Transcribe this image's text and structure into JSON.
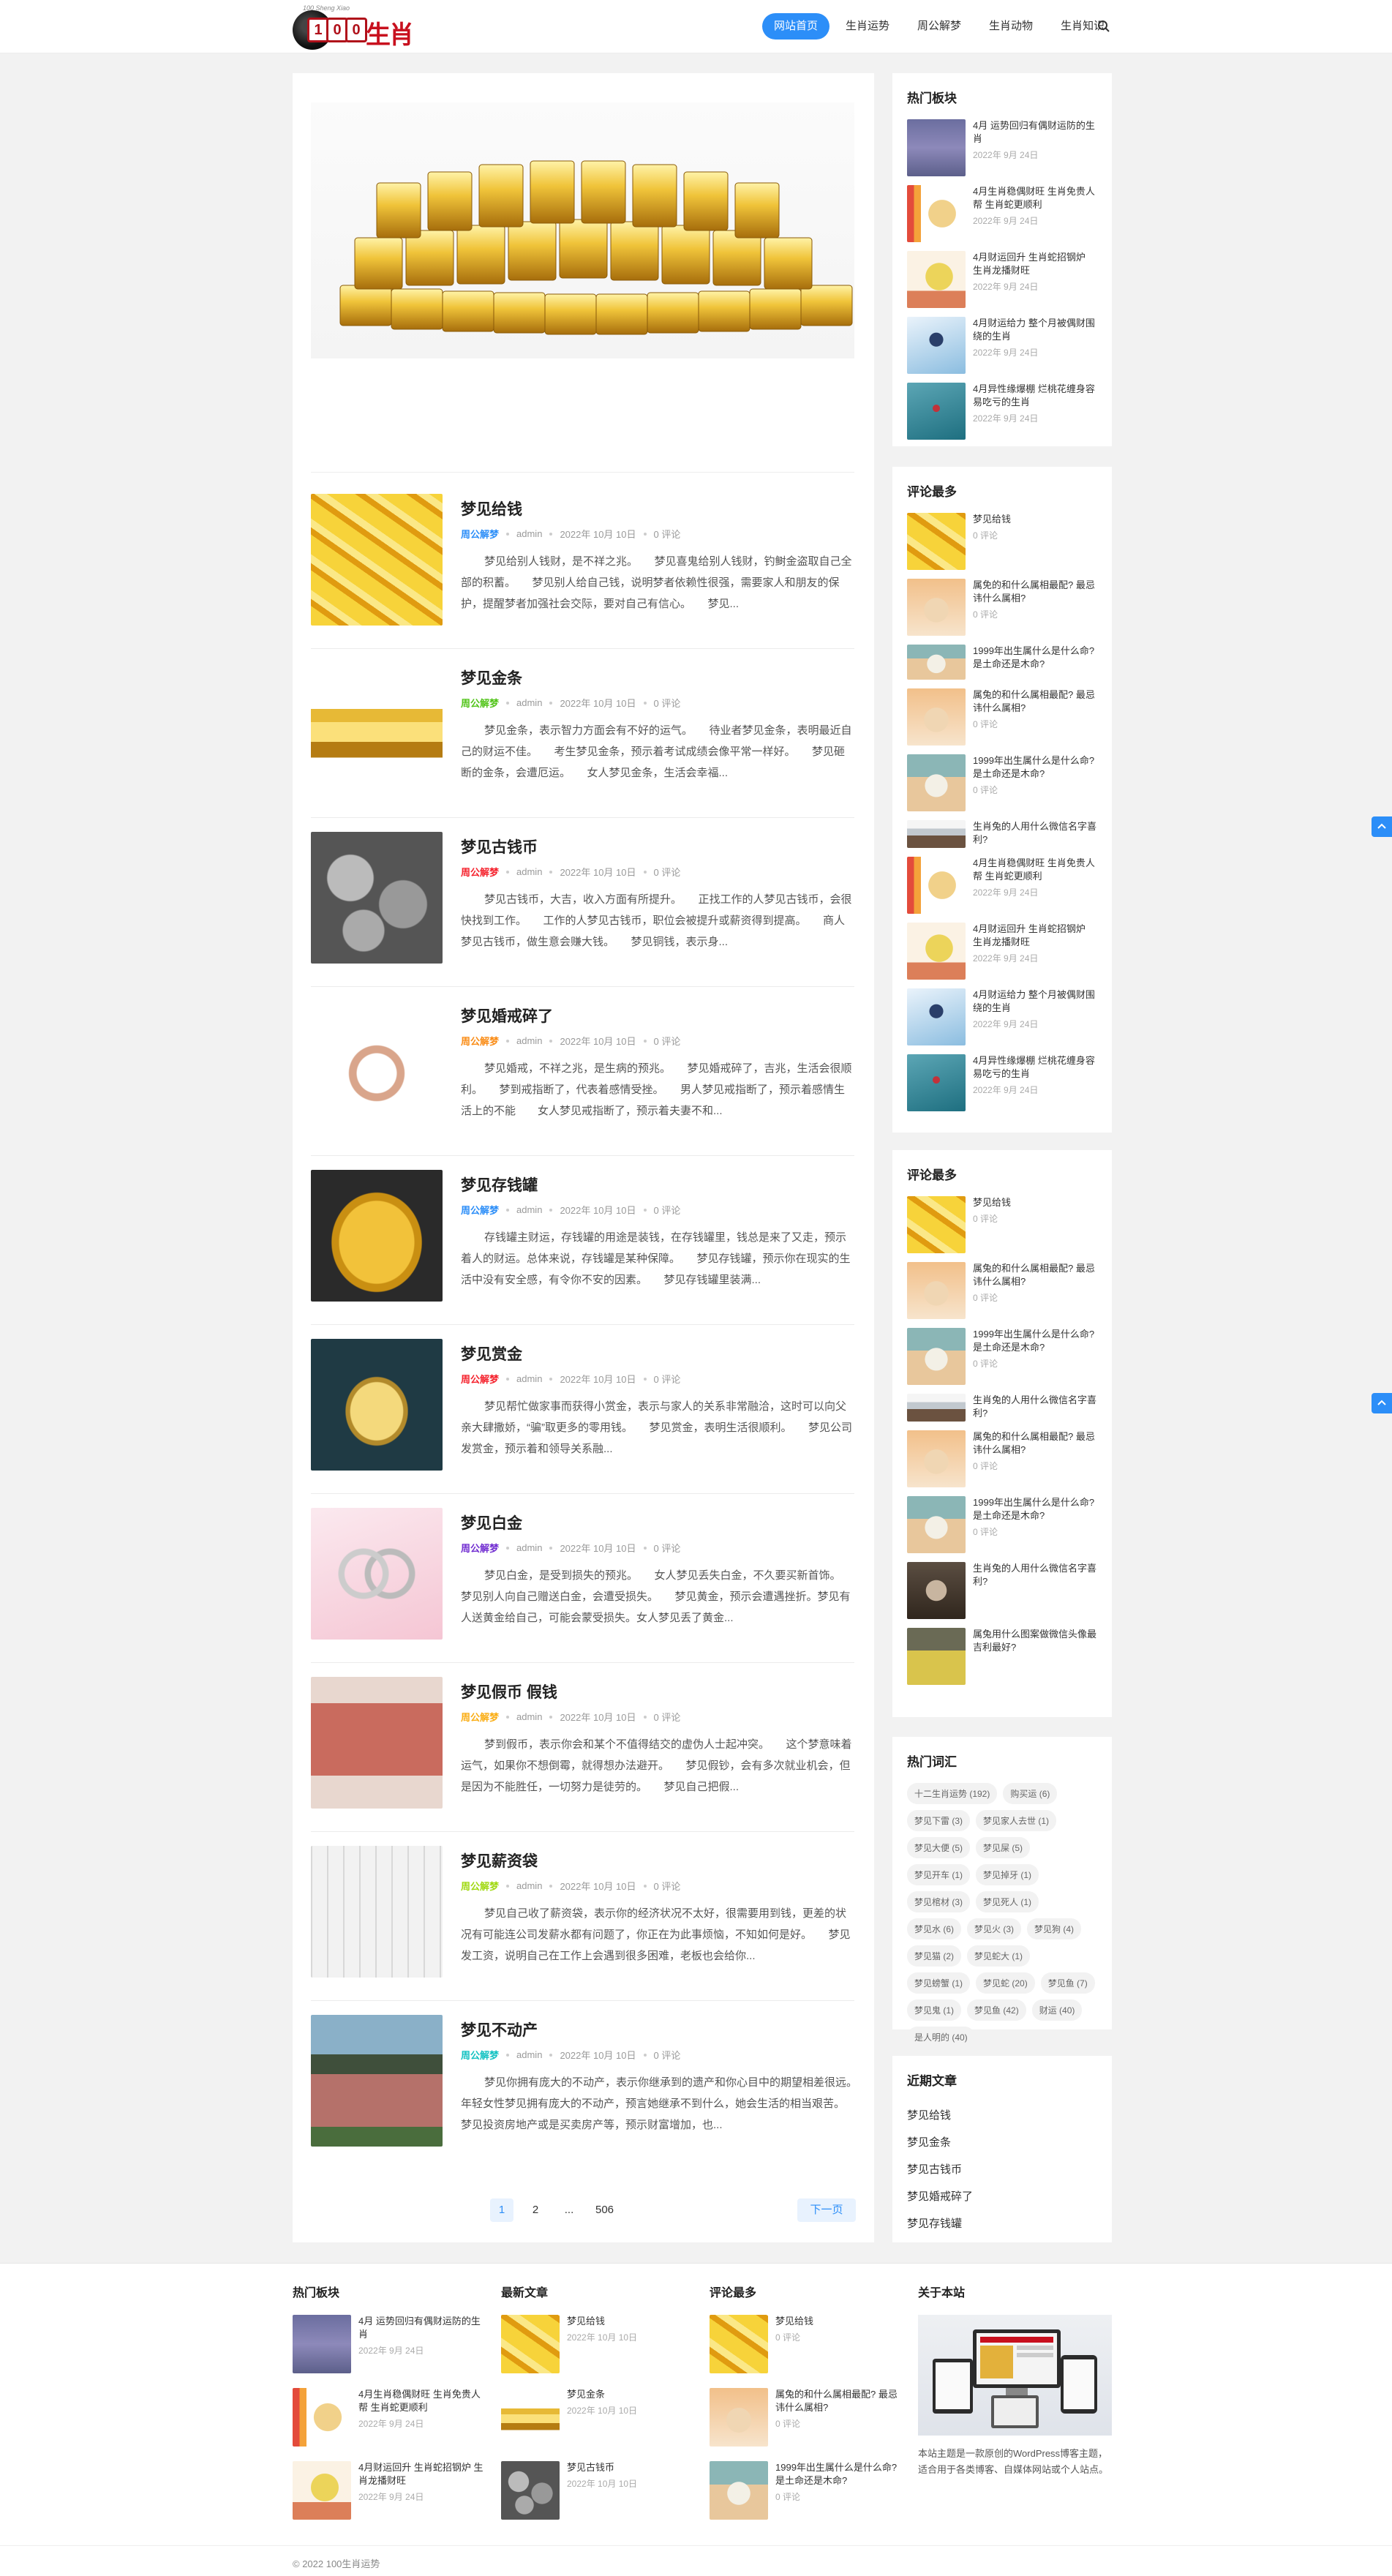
{
  "header": {
    "logo_tagline": "100 Sheng Xiao",
    "logo_digit_1": "1",
    "logo_digit_2": "0",
    "logo_digit_3": "0",
    "logo_text": "生肖",
    "nav": [
      "网站首页",
      "生肖运势",
      "周公解梦",
      "生肖动物",
      "生肖知识"
    ]
  },
  "posts": [
    {
      "title": "梦见给钱",
      "category": "周公解梦",
      "cat_color": "#2c8ef8",
      "author": "admin",
      "date": "2022年 10月 10日",
      "comments": "0 评论",
      "excerpt": "梦见给别人钱财，是不祥之兆。　　梦见喜鬼给别人钱财，钓鲥金盗取自己全部的积蓄。　　梦见别人给自己钱，说明梦者依赖性很强，需要家人和朋友的保护，提醒梦者加强社会交际，要对自己有信心。　　梦见..."
    },
    {
      "title": "梦见金条",
      "category": "周公解梦",
      "cat_color": "#52c41a",
      "author": "admin",
      "date": "2022年 10月 10日",
      "comments": "0 评论",
      "excerpt": "梦见金条，表示智力方面会有不好的运气。　　待业者梦见金条，表明最近自己的财运不佳。　　考生梦见金条，预示着考试成绩会像平常一样好。　　梦见砸断的金条，会遭厄运。　　女人梦见金条，生活会幸福..."
    },
    {
      "title": "梦见古钱币",
      "category": "周公解梦",
      "cat_color": "#f5222d",
      "author": "admin",
      "date": "2022年 10月 10日",
      "comments": "0 评论",
      "excerpt": "梦见古钱币，大吉，收入方面有所提升。　　正找工作的人梦见古钱币，会很快找到工作。　　工作的人梦见古钱币，职位会被提升或薪资得到提高。　　商人梦见古钱币，做生意会赚大钱。　　梦见铜钱，表示身..."
    },
    {
      "title": "梦见婚戒碎了",
      "category": "周公解梦",
      "cat_color": "#fa8c16",
      "author": "admin",
      "date": "2022年 10月 10日",
      "comments": "0 评论",
      "excerpt": "梦见婚戒，不祥之兆，是生病的预兆。　　梦见婚戒碎了，吉兆，生活会很顺利。　　梦到戒指断了，代表着感情受挫。　　男人梦见戒指断了，预示着感情生活上的不能　　女人梦见戒指断了，预示着夫妻不和..."
    },
    {
      "title": "梦见存钱罐",
      "category": "周公解梦",
      "cat_color": "#2c8ef8",
      "author": "admin",
      "date": "2022年 10月 10日",
      "comments": "0 评论",
      "excerpt": "存钱罐主财运，存钱罐的用途是装钱，在存钱罐里，钱总是来了又走，预示着人的财运。总体来说，存钱罐是某种保障。　　梦见存钱罐，预示你在现实的生活中没有安全感，有令你不安的因素。　　梦见存钱罐里装满..."
    },
    {
      "title": "梦见赏金",
      "category": "周公解梦",
      "cat_color": "#f5222d",
      "author": "admin",
      "date": "2022年 10月 10日",
      "comments": "0 评论",
      "excerpt": "梦见帮忙做家事而获得小赏金，表示与家人的关系非常融洽，这时可以向父亲大肆撒娇，“骗”取更多的零用钱。　　梦见赏金，表明生活很顺利。　　梦见公司发赏金，预示着和领导关系融..."
    },
    {
      "title": "梦见白金",
      "category": "周公解梦",
      "cat_color": "#722ed1",
      "author": "admin",
      "date": "2022年 10月 10日",
      "comments": "0 评论",
      "excerpt": "梦见白金，是受到损失的预兆。　　女人梦见丢失白金，不久要买新首饰。　　梦见别人向自己赠送白金，会遭受损失。　　梦见黄金，预示会遭遇挫折。梦见有人送黄金给自己，可能会蒙受损失。女人梦见丢了黄金..."
    },
    {
      "title": "梦见假币 假钱",
      "category": "周公解梦",
      "cat_color": "#faad14",
      "author": "admin",
      "date": "2022年 10月 10日",
      "comments": "0 评论",
      "excerpt": "梦到假币，表示你会和某个不值得结交的虚伪人士起冲突。　　这个梦意味着运气，如果你不想倒霉，就得想办法避开。　　梦见假钞，会有多次就业机会，但是因为不能胜任，一切努力是徒劳的。　　梦见自己把假..."
    },
    {
      "title": "梦见薪资袋",
      "category": "周公解梦",
      "cat_color": "#a0d911",
      "author": "admin",
      "date": "2022年 10月 10日",
      "comments": "0 评论",
      "excerpt": "梦见自己收了薪资袋，表示你的经济状况不太好，很需要用到钱，更差的状况有可能连公司发薪水都有问题了，你正在为此事烦恼，不知如何是好。　　梦见发工资，说明自己在工作上会遇到很多困难，老板也会给你..."
    },
    {
      "title": "梦见不动产",
      "category": "周公解梦",
      "cat_color": "#13c2c2",
      "author": "admin",
      "date": "2022年 10月 10日",
      "comments": "0 评论",
      "excerpt": "梦见你拥有庞大的不动产，表示你继承到的遗产和你心目中的期望相差很远。　　年轻女性梦见拥有庞大的不动产，预言她继承不到什么，她会生活的相当艰苦。　　梦见投资房地产或是买卖房产等，预示财富增加，也..."
    }
  ],
  "pagination": {
    "page1": "1",
    "page2": "2",
    "ellipsis": "...",
    "last": "506",
    "next": "下一页"
  },
  "sidebar": {
    "hot": {
      "title": "热门板块",
      "items": [
        {
          "title": "4月 运势回归有偶财运防的生肖",
          "date": "2022年 9月 24日"
        },
        {
          "title": "4月生肖稳偶财旺 生肖免贵人帮 生肖蛇更顺利",
          "date": "2022年 9月 24日"
        },
        {
          "title": "4月财运回升 生肖蛇招钢炉 生肖龙播财旺",
          "date": "2022年 9月 24日"
        },
        {
          "title": "4月财运给力 整个月被偶财围绕的生肖",
          "date": "2022年 9月 24日"
        },
        {
          "title": "4月异性缘爆棚 烂桃花缠身容易吃亏的生肖",
          "date": "2022年 9月 24日"
        }
      ]
    },
    "comments1": {
      "title": "评论最多",
      "items": [
        {
          "title": "梦见给钱",
          "count": "0 评论"
        },
        {
          "title": "属免的和什么属相最配? 最忌讳什么属相?",
          "count": "0 评论"
        },
        {
          "title": "1999年出生属什么是什么命? 是土命还是木命?",
          "count": ""
        },
        {
          "title": "属兔的和什么属相最配? 最忌讳什么属相?",
          "count": "0 评论"
        },
        {
          "title": "1999年出生属什么是什么命? 是土命还是木命?",
          "count": "0 评论"
        },
        {
          "title": "生肖兔的人用什么微信名字喜利?",
          "count": ""
        },
        {
          "title": "4月生肖稳偶财旺 生肖免贵人帮 生肖蛇更顺利",
          "count": "2022年 9月 24日"
        },
        {
          "title": "4月财运回升 生肖蛇招钢炉 生肖龙播财旺",
          "count": "2022年 9月 24日"
        },
        {
          "title": "4月财运给力 整个月被偶财围绕的生肖",
          "count": "2022年 9月 24日"
        },
        {
          "title": "4月异性缘爆棚 烂桃花缠身容易吃亏的生肖",
          "count": "2022年 9月 24日"
        }
      ]
    },
    "comments2": {
      "title": "评论最多",
      "items": [
        {
          "title": "梦见给钱",
          "count": "0 评论"
        },
        {
          "title": "属兔的和什么属相最配? 最忌讳什么属相?",
          "count": "0 评论"
        },
        {
          "title": "1999年出生属什么是什么命? 是土命还是木命?",
          "count": "0 评论"
        },
        {
          "title": "生肖兔的人用什么微信名字喜利?",
          "count": ""
        },
        {
          "title": "属兔的和什么属相最配? 最忌讳什么属相?",
          "count": "0 评论"
        },
        {
          "title": "1999年出生属什么是什么命? 是土命还是木命?",
          "count": "0 评论"
        },
        {
          "title": "生肖兔的人用什么微信名字喜利?",
          "count": ""
        },
        {
          "title": "属兔用什么图案做微信头像最吉利最好?",
          "count": ""
        }
      ]
    },
    "tags": {
      "title": "热门词汇",
      "items": [
        "十二生肖运势 (192)",
        "购买运 (6)",
        "梦见下雷 (3)",
        "梦见家人去世 (1)",
        "梦见大便 (5)",
        "梦见屎 (5)",
        "梦见开车 (1)",
        "梦见掉牙 (1)",
        "梦见棺材 (3)",
        "梦见死人 (1)",
        "梦见水 (6)",
        "梦见火 (3)",
        "梦见狗 (4)",
        "梦见猫 (2)",
        "梦见蛇大 (1)",
        "梦见螃蟹 (1)",
        "梦见蛇 (20)",
        "梦见鱼 (7)",
        "梦见鬼 (1)",
        "梦见鱼 (42)",
        "财运 (40)",
        "是人明的 (40)"
      ]
    },
    "recent": {
      "title": "近期文章",
      "items": [
        "梦见给钱",
        "梦见金条",
        "梦见古钱币",
        "梦见婚戒碎了",
        "梦见存钱罐"
      ]
    }
  },
  "footer": {
    "col1": {
      "title": "热门板块",
      "items": [
        {
          "title": "4月 运势回归有偶财运防的生肖",
          "date": "2022年 9月 24日"
        },
        {
          "title": "4月生肖稳偶财旺 生肖免贵人帮 生肖蛇更顺利",
          "date": "2022年 9月 24日"
        },
        {
          "title": "4月财运回升 生肖蛇招钢炉 生肖龙播财旺",
          "date": "2022年 9月 24日"
        }
      ]
    },
    "col2": {
      "title": "最新文章",
      "items": [
        {
          "title": "梦见给钱",
          "date": "2022年 10月 10日"
        },
        {
          "title": "梦见金条",
          "date": "2022年 10月 10日"
        },
        {
          "title": "梦见古钱币",
          "date": "2022年 10月 10日"
        }
      ]
    },
    "col3": {
      "title": "评论最多",
      "items": [
        {
          "title": "梦见给钱",
          "date": "0 评论"
        },
        {
          "title": "属兔的和什么属相最配? 最忌讳什么属相?",
          "date": "0 评论"
        },
        {
          "title": "1999年出生属什么是什么命? 是土命还是木命?",
          "date": "0 评论"
        }
      ]
    },
    "col4": {
      "title": "关于本站",
      "text": "本站主题是一款原创的WordPress博客主题，适合用于各类博客、自媒体网站或个人站点。"
    },
    "copyright": "© 2022 100生肖运势"
  }
}
